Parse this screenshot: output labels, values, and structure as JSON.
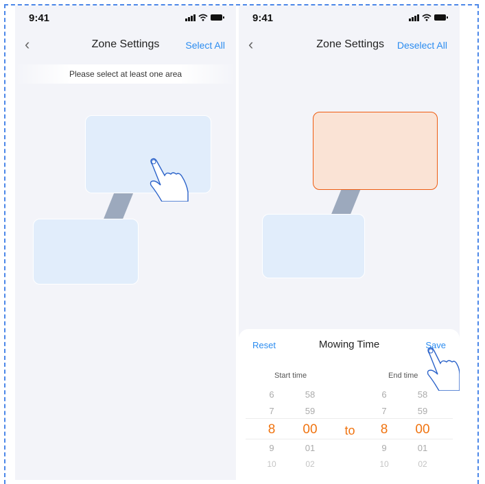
{
  "status": {
    "time": "9:41"
  },
  "colors": {
    "accent": "#2b8cf0",
    "zone_fill": "#e1edfb",
    "zone_selected_fill": "#fae3d5",
    "zone_selected_border": "#ee5b0f",
    "time_selected": "#f0730f",
    "connector": "#9ca9bd"
  },
  "left": {
    "title": "Zone Settings",
    "action": "Select All",
    "hint": "Please select at least one area"
  },
  "right": {
    "title": "Zone Settings",
    "action": "Deselect All",
    "sheet": {
      "reset": "Reset",
      "title": "Mowing Time",
      "save": "Save",
      "start_label": "Start time",
      "end_label": "End time",
      "to": "to",
      "start_hours": [
        "6",
        "7",
        "8",
        "9",
        "10"
      ],
      "start_minutes": [
        "58",
        "59",
        "00",
        "01",
        "02"
      ],
      "end_hours": [
        "6",
        "7",
        "8",
        "9",
        "10"
      ],
      "end_minutes": [
        "58",
        "59",
        "00",
        "01",
        "02"
      ]
    }
  },
  "icons": [
    "back-chevron-icon",
    "signal-icon",
    "wifi-icon",
    "battery-icon",
    "tap-hand-icon"
  ]
}
